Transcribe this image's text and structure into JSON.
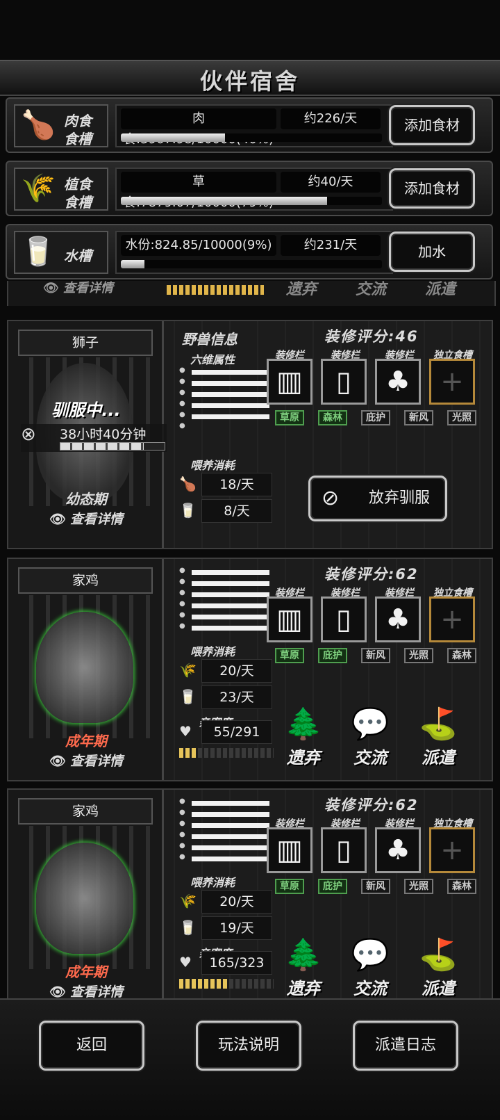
{
  "header": {
    "title": "伙伴宿舍"
  },
  "troughs": [
    {
      "name_line1": "肉食",
      "name_line2": "食槽",
      "icon": "meat-icon",
      "icon_glyph": "🍗",
      "amount": "肉食:3967.98/10000(40%)",
      "rate": "约226/天",
      "fill": 0.4,
      "button": "添加食材"
    },
    {
      "name_line1": "植食",
      "name_line2": "食槽",
      "icon": "grass-icon",
      "icon_glyph": "🌾",
      "amount": "草食:7879.07/10000(79%)",
      "rate": "约40/天",
      "fill": 0.79,
      "button": "添加食材"
    },
    {
      "name_line1": "水槽",
      "name_line2": "",
      "icon": "water-cup-icon",
      "icon_glyph": "🥛",
      "amount": "水份:824.85/10000(9%)",
      "rate": "约231/天",
      "fill": 0.09,
      "button": "加水"
    }
  ],
  "partial_row": {
    "detail": "查看详情",
    "actions": [
      "遗弃",
      "交流",
      "派遣"
    ]
  },
  "lion": {
    "name": "狮子",
    "status": "驯服中...",
    "time_left": "38小时40分钟",
    "taming_progress": 0.8,
    "stage": "幼态期",
    "detail": "查看详情",
    "info_title": "野兽信息",
    "six_stats_title": "六维属性",
    "feed_title": "喂养消耗",
    "meat_per_day": "18/天",
    "water_per_day": "8/天",
    "score": "装修评分:46",
    "slot_label": "装修栏",
    "slot_label_food": "独立食槽",
    "tags": [
      {
        "t": "草原",
        "on": true
      },
      {
        "t": "森林",
        "on": true
      },
      {
        "t": "庇护",
        "on": false
      },
      {
        "t": "新风",
        "on": false
      },
      {
        "t": "光照",
        "on": false
      }
    ],
    "abandon": "放弃驯服"
  },
  "chickens": [
    {
      "name": "家鸡",
      "stage": "成年期",
      "detail": "查看详情",
      "feed_title": "喂养消耗",
      "plant_per_day": "20/天",
      "water_per_day": "23/天",
      "affinity_title": "亲密度",
      "affinity": "55/291",
      "affinity_fill": 0.19,
      "score": "装修评分:62",
      "tags": [
        {
          "t": "草原",
          "on": true
        },
        {
          "t": "庇护",
          "on": true
        },
        {
          "t": "新风",
          "on": false
        },
        {
          "t": "光照",
          "on": false
        },
        {
          "t": "森林",
          "on": false
        }
      ],
      "actions": [
        "遗弃",
        "交流",
        "派遣"
      ]
    },
    {
      "name": "家鸡",
      "stage": "成年期",
      "detail": "查看详情",
      "feed_title": "喂养消耗",
      "plant_per_day": "20/天",
      "water_per_day": "19/天",
      "affinity_title": "亲密度",
      "affinity": "165/323",
      "affinity_fill": 0.51,
      "score": "装修评分:62",
      "tags": [
        {
          "t": "草原",
          "on": true
        },
        {
          "t": "庇护",
          "on": true
        },
        {
          "t": "新风",
          "on": false
        },
        {
          "t": "光照",
          "on": false
        },
        {
          "t": "森林",
          "on": false
        }
      ],
      "actions": [
        "遗弃",
        "交流",
        "派遣"
      ]
    }
  ],
  "footer": {
    "back": "返回",
    "help": "玩法说明",
    "log": "派遣日志"
  },
  "colors": {
    "accent_green": "#7fd07f",
    "stage_red": "#ff6a4d",
    "gold_slot": "#b5893a"
  }
}
